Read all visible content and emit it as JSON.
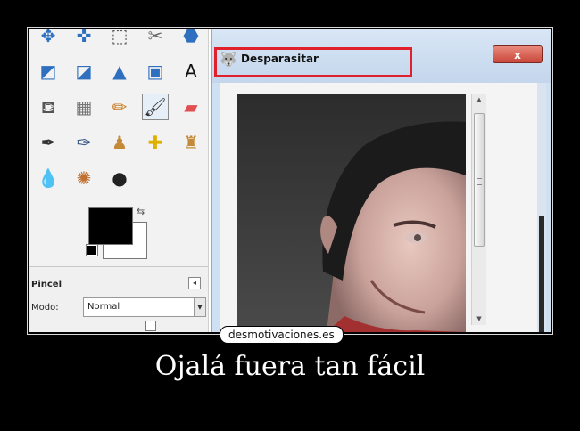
{
  "toolbox": {
    "tools": [
      {
        "icon": "fuzzy-select-icon",
        "glyph": "✥",
        "color": "#2f6fc0"
      },
      {
        "icon": "move-icon",
        "glyph": "✜",
        "color": "#2f6fc0"
      },
      {
        "icon": "align-icon",
        "glyph": "⬚",
        "color": "#555555"
      },
      {
        "icon": "crop-icon",
        "glyph": "✂",
        "color": "#666666"
      },
      {
        "icon": "transform-icon",
        "glyph": "⬣",
        "color": "#2f6fc0"
      },
      {
        "icon": "perspective-icon",
        "glyph": "◩",
        "color": "#2f6fc0"
      },
      {
        "icon": "flip-icon",
        "glyph": "◪",
        "color": "#2f6fc0"
      },
      {
        "icon": "cage-icon",
        "glyph": "▲",
        "color": "#2f6fc0"
      },
      {
        "icon": "text-tool-icon",
        "glyph": "▣",
        "color": "#2f6fc0"
      },
      {
        "icon": "text-icon",
        "glyph": "A",
        "color": "#111111"
      },
      {
        "icon": "bucket-fill-icon",
        "glyph": "⛾",
        "color": "#555555"
      },
      {
        "icon": "gradient-icon",
        "glyph": "▦",
        "color": "#777777"
      },
      {
        "icon": "pencil-icon",
        "glyph": "✏",
        "color": "#c77a1a"
      },
      {
        "icon": "paintbrush-icon",
        "glyph": "🖌",
        "color": "#333333"
      },
      {
        "icon": "eraser-icon",
        "glyph": "▰",
        "color": "#e05050"
      },
      {
        "icon": "airbrush-icon",
        "glyph": "✒",
        "color": "#333333"
      },
      {
        "icon": "ink-icon",
        "glyph": "✑",
        "color": "#2f4f7f"
      },
      {
        "icon": "clone-icon",
        "glyph": "♟",
        "color": "#c48a3a"
      },
      {
        "icon": "heal-icon",
        "glyph": "✚",
        "color": "#e0b000"
      },
      {
        "icon": "perspective-clone-icon",
        "glyph": "♜",
        "color": "#c48a3a"
      },
      {
        "icon": "blur-icon",
        "glyph": "💧",
        "color": "#2f6fc0"
      },
      {
        "icon": "smudge-icon",
        "glyph": "✺",
        "color": "#c07030"
      },
      {
        "icon": "dodge-burn-icon",
        "glyph": "●",
        "color": "#222222"
      }
    ],
    "colors": {
      "foreground": "#000000",
      "background": "#ffffff"
    }
  },
  "tool_options": {
    "title": "Pincel",
    "mode_label": "Modo:",
    "mode_value": "Normal"
  },
  "dialog": {
    "title": "Desparasitar",
    "close_label": "x"
  },
  "watermark": "desmotivaciones.es",
  "caption": "Ojalá fuera tan fácil"
}
